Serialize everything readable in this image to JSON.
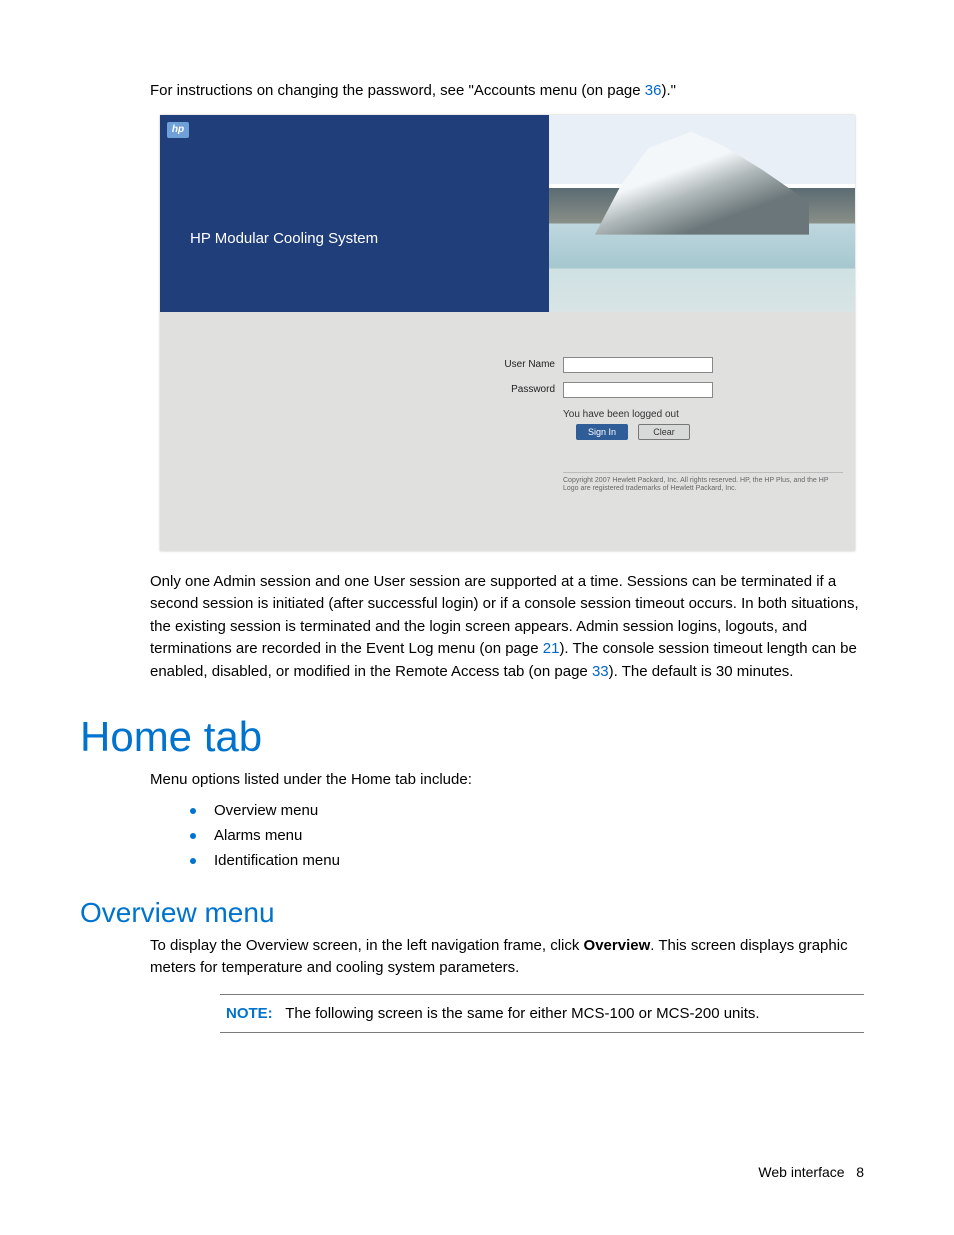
{
  "intro": {
    "prefix": "For instructions on changing the password, see \"Accounts menu (on page ",
    "page_ref": "36",
    "suffix": ").\""
  },
  "screenshot": {
    "logo_text": "hp",
    "title": "HP Modular Cooling System",
    "username_label": "User Name",
    "password_label": "Password",
    "username_value": "",
    "password_value": "",
    "status": "You have been logged out",
    "signin_btn": "Sign In",
    "clear_btn": "Clear",
    "copyright": "Copyright 2007 Hewlett Packard, Inc. All rights reserved. HP, the HP Plus, and the HP Logo are registered trademarks of Hewlett Packard, Inc."
  },
  "body_para": {
    "t1": "Only one Admin session and one User session are supported at a time. Sessions can be terminated if a second session is initiated (after successful login) or if a console session timeout occurs. In both situations, the existing session is terminated and the login screen appears. Admin session logins, logouts, and terminations are recorded in the Event Log menu (on page ",
    "ref1": "21",
    "t2": "). The console session timeout length can be enabled, disabled, or modified in the Remote Access tab (on page ",
    "ref2": "33",
    "t3": "). The default is 30 minutes."
  },
  "home": {
    "heading": "Home tab",
    "intro": "Menu options listed under the Home tab include:",
    "items": [
      "Overview menu",
      "Alarms menu",
      "Identification menu"
    ]
  },
  "overview": {
    "heading": "Overview menu",
    "p1a": "To display the Overview screen, in the left navigation frame, click ",
    "bold": "Overview",
    "p1b": ". This screen displays graphic meters for temperature and cooling system parameters.",
    "note_label": "NOTE:",
    "note_text": "The following screen is the same for either MCS-100 or MCS-200 units."
  },
  "footer": {
    "label": "Web interface",
    "page": "8"
  }
}
